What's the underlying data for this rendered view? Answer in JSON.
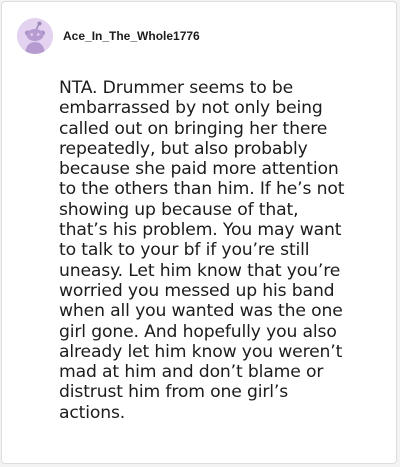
{
  "comment": {
    "username": "Ace_In_The_Whole1776",
    "avatar_icon": "reddit-snoo-avatar-icon",
    "avatar_bg": "#e3d3f0",
    "body": "NTA. Drummer seems to be\nembarrassed by not only being\ncalled out on bringing her there\nrepeatedly, but also probably\nbecause she paid more attention\nto the others than him. If he’s not\nshowing up because of that,\nthat’s his problem. You may want\nto talk to your bf if you’re still\nuneasy. Let him know that you’re\nworried you messed up his band\nwhen all you wanted was the one\ngirl gone. And hopefully you also\nalready let him know you weren’t\nmad at him and don’t blame or\ndistrust him from one girl’s\nactions."
  }
}
